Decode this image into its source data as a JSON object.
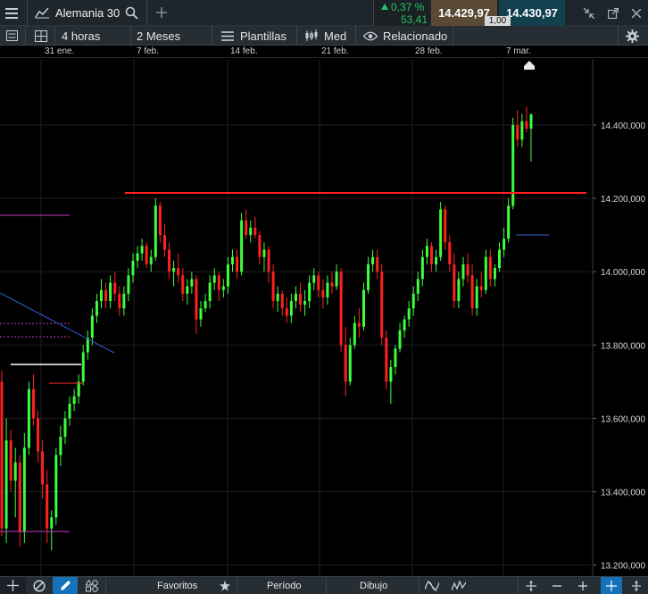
{
  "header": {
    "instrument": "Alemania 30",
    "change_pct": "0,37 %",
    "change_abs": "53,41",
    "bid": "14.429,97",
    "ask": "14.430,97",
    "spread": "1,00",
    "up_color": "#22c55e"
  },
  "toolbar": {
    "interval": "4 horas",
    "range": "2 Meses",
    "templates": "Plantillas",
    "chart_style": "Med",
    "related": "Relacionado"
  },
  "dates": [
    "31 ene.",
    "7 feb.",
    "14 feb.",
    "21 feb.",
    "28 feb.",
    "7 mar."
  ],
  "bottom": {
    "favorites": "Favoritos",
    "period": "Período",
    "drawing": "Dibujo"
  },
  "chart_data": {
    "type": "candlestick",
    "y_ticks": [
      "14.400,000",
      "14.200,000",
      "14.000,000",
      "13.800,000",
      "13.600,000",
      "13.400,000",
      "13.200,000"
    ],
    "y_tick_values": [
      14400,
      14200,
      14000,
      13800,
      13600,
      13400,
      13200
    ],
    "ylim": [
      13170,
      14580
    ],
    "up_color": "#3cff3c",
    "down_color": "#ff2020",
    "ohlc": [
      [
        13700,
        13730,
        13280,
        13300
      ],
      [
        13300,
        13600,
        13260,
        13540
      ],
      [
        13540,
        13570,
        13400,
        13430
      ],
      [
        13430,
        13520,
        13330,
        13480
      ],
      [
        13480,
        13500,
        13250,
        13290
      ],
      [
        13290,
        13560,
        13260,
        13520
      ],
      [
        13520,
        13700,
        13500,
        13680
      ],
      [
        13680,
        13720,
        13580,
        13600
      ],
      [
        13600,
        13620,
        13480,
        13510
      ],
      [
        13510,
        13540,
        13380,
        13420
      ],
      [
        13420,
        13460,
        13260,
        13300
      ],
      [
        13300,
        13350,
        13240,
        13330
      ],
      [
        13330,
        13520,
        13310,
        13500
      ],
      [
        13500,
        13580,
        13470,
        13550
      ],
      [
        13550,
        13620,
        13530,
        13600
      ],
      [
        13600,
        13660,
        13580,
        13640
      ],
      [
        13640,
        13680,
        13620,
        13660
      ],
      [
        13660,
        13720,
        13640,
        13700
      ],
      [
        13700,
        13800,
        13690,
        13780
      ],
      [
        13780,
        13840,
        13760,
        13820
      ],
      [
        13820,
        13900,
        13800,
        13880
      ],
      [
        13880,
        13940,
        13860,
        13920
      ],
      [
        13920,
        13980,
        13900,
        13950
      ],
      [
        13950,
        13970,
        13900,
        13920
      ],
      [
        13920,
        13990,
        13900,
        13970
      ],
      [
        13970,
        14000,
        13920,
        13940
      ],
      [
        13940,
        13960,
        13880,
        13900
      ],
      [
        13900,
        13960,
        13880,
        13940
      ],
      [
        13940,
        14010,
        13920,
        13990
      ],
      [
        13990,
        14050,
        13970,
        14030
      ],
      [
        14030,
        14070,
        14010,
        14050
      ],
      [
        14050,
        14090,
        14030,
        14070
      ],
      [
        14070,
        14080,
        14010,
        14020
      ],
      [
        14020,
        14060,
        14000,
        14040
      ],
      [
        14040,
        14200,
        14030,
        14180
      ],
      [
        14180,
        14190,
        14080,
        14100
      ],
      [
        14100,
        14130,
        14040,
        14060
      ],
      [
        14060,
        14080,
        13980,
        14000
      ],
      [
        14000,
        14030,
        13960,
        14010
      ],
      [
        14010,
        14050,
        13970,
        13990
      ],
      [
        13990,
        14010,
        13920,
        13940
      ],
      [
        13940,
        13980,
        13910,
        13960
      ],
      [
        13960,
        14000,
        13940,
        13980
      ],
      [
        13980,
        13990,
        13830,
        13870
      ],
      [
        13870,
        13920,
        13850,
        13900
      ],
      [
        13900,
        13940,
        13890,
        13920
      ],
      [
        13920,
        13990,
        13900,
        13970
      ],
      [
        13970,
        14010,
        13950,
        13990
      ],
      [
        13990,
        14000,
        13920,
        13950
      ],
      [
        13950,
        13980,
        13930,
        13960
      ],
      [
        13960,
        14040,
        13940,
        14020
      ],
      [
        14020,
        14060,
        14000,
        14040
      ],
      [
        14040,
        14060,
        13980,
        14000
      ],
      [
        14000,
        14160,
        13990,
        14140
      ],
      [
        14140,
        14170,
        14090,
        14100
      ],
      [
        14100,
        14140,
        14080,
        14120
      ],
      [
        14120,
        14150,
        14090,
        14100
      ],
      [
        14100,
        14110,
        14020,
        14040
      ],
      [
        14040,
        14080,
        14000,
        14060
      ],
      [
        14060,
        14070,
        13970,
        14000
      ],
      [
        14000,
        14020,
        13900,
        13920
      ],
      [
        13920,
        13960,
        13890,
        13940
      ],
      [
        13940,
        13950,
        13880,
        13900
      ],
      [
        13900,
        13930,
        13860,
        13880
      ],
      [
        13880,
        13940,
        13860,
        13920
      ],
      [
        13920,
        13960,
        13900,
        13940
      ],
      [
        13940,
        13970,
        13890,
        13910
      ],
      [
        13910,
        13950,
        13880,
        13920
      ],
      [
        13920,
        13990,
        13900,
        13970
      ],
      [
        13970,
        14010,
        13950,
        13990
      ],
      [
        13990,
        14000,
        13930,
        13950
      ],
      [
        13950,
        13980,
        13900,
        13930
      ],
      [
        13930,
        13990,
        13910,
        13970
      ],
      [
        13970,
        14000,
        13940,
        13960
      ],
      [
        13960,
        14020,
        13950,
        14000
      ],
      [
        14000,
        14010,
        13780,
        13800
      ],
      [
        13800,
        13850,
        13660,
        13700
      ],
      [
        13700,
        13820,
        13690,
        13800
      ],
      [
        13800,
        13880,
        13790,
        13860
      ],
      [
        13860,
        13900,
        13820,
        13850
      ],
      [
        13850,
        13970,
        13840,
        13950
      ],
      [
        13950,
        14040,
        13940,
        14020
      ],
      [
        14020,
        14060,
        14000,
        14040
      ],
      [
        14040,
        14060,
        13980,
        14000
      ],
      [
        14000,
        14020,
        13800,
        13820
      ],
      [
        13820,
        13840,
        13680,
        13700
      ],
      [
        13700,
        13760,
        13640,
        13740
      ],
      [
        13740,
        13800,
        13720,
        13790
      ],
      [
        13790,
        13860,
        13780,
        13840
      ],
      [
        13840,
        13880,
        13820,
        13870
      ],
      [
        13870,
        13920,
        13850,
        13900
      ],
      [
        13900,
        13960,
        13880,
        13940
      ],
      [
        13940,
        14000,
        13920,
        13980
      ],
      [
        13980,
        14060,
        13960,
        14040
      ],
      [
        14040,
        14090,
        14020,
        14070
      ],
      [
        14070,
        14080,
        14000,
        14020
      ],
      [
        14020,
        14060,
        14000,
        14040
      ],
      [
        14040,
        14190,
        14030,
        14170
      ],
      [
        14170,
        14180,
        14060,
        14080
      ],
      [
        14080,
        14100,
        14000,
        14020
      ],
      [
        14020,
        14050,
        13900,
        13920
      ],
      [
        13920,
        14000,
        13900,
        13980
      ],
      [
        13980,
        14040,
        13960,
        14020
      ],
      [
        14020,
        14050,
        13970,
        13990
      ],
      [
        13990,
        14020,
        13880,
        13900
      ],
      [
        13900,
        13980,
        13880,
        13960
      ],
      [
        13960,
        14000,
        13930,
        13950
      ],
      [
        13950,
        14060,
        13940,
        14040
      ],
      [
        14040,
        14060,
        13960,
        13980
      ],
      [
        13980,
        14020,
        13960,
        14010
      ],
      [
        14010,
        14080,
        14000,
        14060
      ],
      [
        14060,
        14120,
        14040,
        14090
      ],
      [
        14090,
        14200,
        14080,
        14180
      ],
      [
        14180,
        14420,
        14170,
        14400
      ],
      [
        14400,
        14440,
        14340,
        14360
      ],
      [
        14360,
        14430,
        14340,
        14410
      ],
      [
        14410,
        14450,
        14380,
        14390
      ],
      [
        14390,
        14420,
        14300,
        14430
      ]
    ]
  }
}
